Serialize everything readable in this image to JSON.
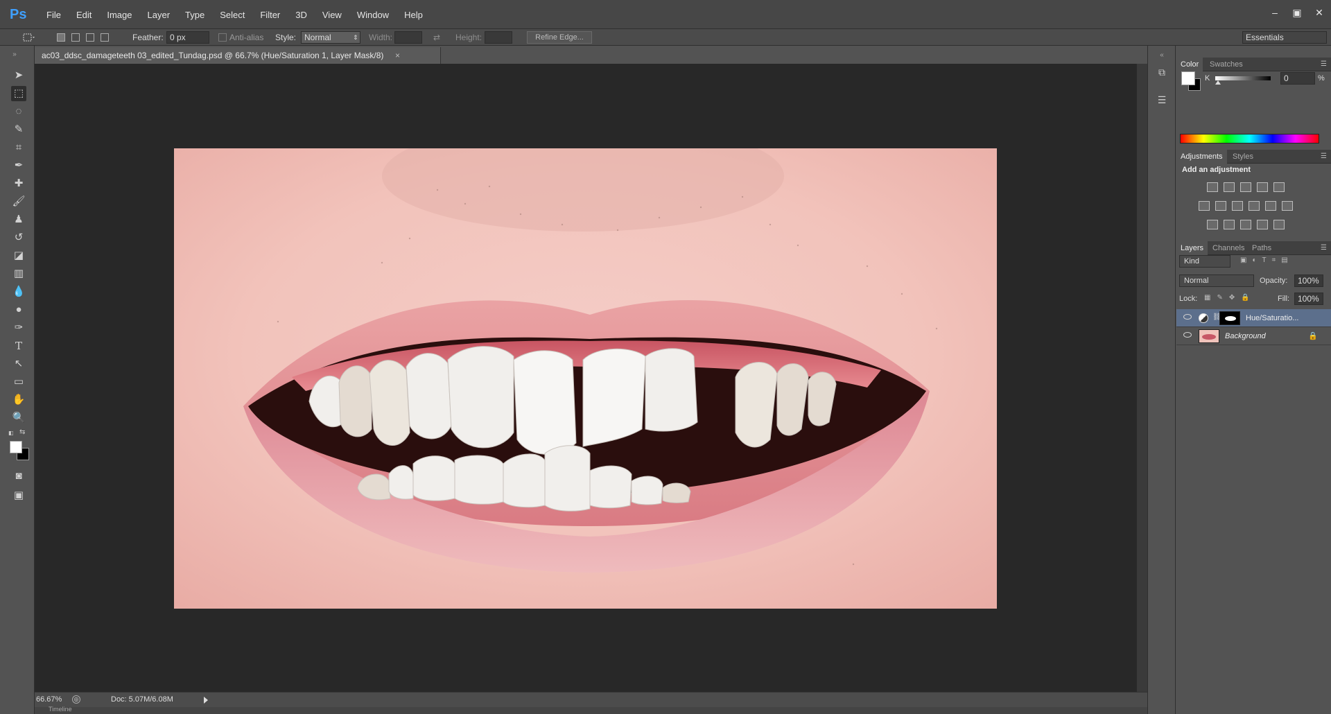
{
  "app": {
    "logo": "Ps",
    "menu": [
      "File",
      "Edit",
      "Image",
      "Layer",
      "Type",
      "Select",
      "Filter",
      "3D",
      "View",
      "Window",
      "Help"
    ],
    "window_controls": [
      "–",
      "▣",
      "✕"
    ]
  },
  "options": {
    "feather_label": "Feather:",
    "feather_value": "0 px",
    "antialias_label": "Anti-alias",
    "style_label": "Style:",
    "style_value": "Normal",
    "width_label": "Width:",
    "height_label": "Height:",
    "refine_edge": "Refine Edge...",
    "workspace": "Essentials"
  },
  "document": {
    "tab_title": "ac03_ddsc_damageteeth 03_edited_Tundag.psd @ 66.7% (Hue/Saturation 1, Layer Mask/8)",
    "close": "×",
    "zoom": "66.67%",
    "doc_size": "Doc: 5.07M/6.08M",
    "timeline": "Timeline"
  },
  "panels": {
    "color": {
      "tabs": [
        "Color",
        "Swatches"
      ],
      "channel_label": "K",
      "value": "0",
      "unit": "%"
    },
    "adjustments": {
      "tabs": [
        "Adjustments",
        "Styles"
      ],
      "heading": "Add an adjustment"
    },
    "layers": {
      "tabs": [
        "Layers",
        "Channels",
        "Paths"
      ],
      "filter_kind": "Kind",
      "blend_mode": "Normal",
      "opacity_label": "Opacity:",
      "opacity_value": "100%",
      "lock_label": "Lock:",
      "fill_label": "Fill:",
      "fill_value": "100%",
      "items": [
        {
          "name": "Hue/Saturatio...",
          "selected": true
        },
        {
          "name": "Background",
          "selected": false
        }
      ]
    }
  },
  "colors": {
    "accent": "#3fa0ff",
    "selection": "#5c6f8c"
  }
}
